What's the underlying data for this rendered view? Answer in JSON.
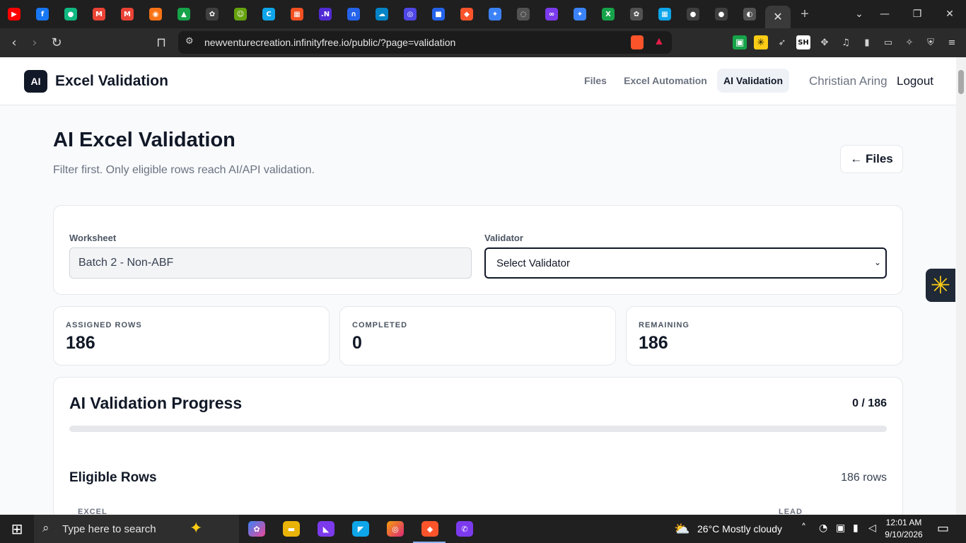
{
  "browser": {
    "tabs": [
      {
        "icon": "youtube-icon",
        "glyph": "▶",
        "color": "#ff0000"
      },
      {
        "icon": "facebook-icon",
        "glyph": "f",
        "color": "#1877f2"
      },
      {
        "icon": "chat-icon",
        "glyph": "●",
        "color": "#10b981"
      },
      {
        "icon": "gmail-icon",
        "glyph": "M",
        "color": "#ea4335"
      },
      {
        "icon": "gmail-icon",
        "glyph": "M",
        "color": "#ea4335"
      },
      {
        "icon": "app-icon",
        "glyph": "◉",
        "color": "#f97316"
      },
      {
        "icon": "drive-icon",
        "glyph": "▲",
        "color": "#16a34a"
      },
      {
        "icon": "openai-icon",
        "glyph": "✿",
        "color": "#3f3f3f"
      },
      {
        "icon": "robot-icon",
        "glyph": "☺",
        "color": "#65a30d"
      },
      {
        "icon": "copilot-icon",
        "glyph": "C",
        "color": "#0ea5e9"
      },
      {
        "icon": "microsoft-icon",
        "glyph": "▦",
        "color": "#f25022"
      },
      {
        "icon": "dotnet-icon",
        "glyph": ".N",
        "color": "#512bd4"
      },
      {
        "icon": "wave-icon",
        "glyph": "∩",
        "color": "#2563eb"
      },
      {
        "icon": "cloud-icon",
        "glyph": "☁",
        "color": "#0284c7"
      },
      {
        "icon": "globe-icon",
        "glyph": "◎",
        "color": "#4f46e5"
      },
      {
        "icon": "square-icon",
        "glyph": "■",
        "color": "#2563eb"
      },
      {
        "icon": "brave-icon",
        "glyph": "◆",
        "color": "#fb542b"
      },
      {
        "icon": "gemini-icon",
        "glyph": "✦",
        "color": "#3b82f6"
      },
      {
        "icon": "loading-icon",
        "glyph": "◌",
        "color": "#525252"
      },
      {
        "icon": "infinity-icon",
        "glyph": "∞",
        "color": "#7c3aed"
      },
      {
        "icon": "gemini-icon",
        "glyph": "✦",
        "color": "#3b82f6"
      },
      {
        "icon": "excel-icon",
        "glyph": "X",
        "color": "#16a34a"
      },
      {
        "icon": "openai-icon",
        "glyph": "✿",
        "color": "#525252"
      },
      {
        "icon": "grid-icon",
        "glyph": "▦",
        "color": "#0ea5e9"
      },
      {
        "icon": "github-icon",
        "glyph": "●",
        "color": "#3f3f3f"
      },
      {
        "icon": "github-icon",
        "glyph": "●",
        "color": "#3f3f3f"
      },
      {
        "icon": "globe-icon",
        "glyph": "◐",
        "color": "#525252"
      }
    ],
    "active_tab_close": "✕",
    "new_tab": "+",
    "url": "newventurecreation.infinityfree.io/public/?page=validation"
  },
  "nav": {
    "logo": "AI",
    "brand": "Excel Validation",
    "links": [
      "Files",
      "Excel Automation",
      "AI Validation"
    ],
    "user": "Christian Aring",
    "logout": "Logout"
  },
  "header": {
    "title": "AI Excel Validation",
    "subtitle": "Filter first. Only eligible rows reach AI/API validation.",
    "files_button": "← Files"
  },
  "filters": {
    "worksheet_label": "Worksheet",
    "worksheet_value": "Batch 2 - Non-ABF",
    "validator_label": "Validator",
    "validator_value": "Select Validator"
  },
  "stats": [
    {
      "label": "ASSIGNED ROWS",
      "value": "186"
    },
    {
      "label": "COMPLETED",
      "value": "0"
    },
    {
      "label": "REMAINING",
      "value": "186"
    }
  ],
  "progress": {
    "title": "AI Validation Progress",
    "count": "0 / 186",
    "fraction": 0,
    "eligible_title": "Eligible Rows",
    "eligible_count": "186 rows",
    "col_excel": "EXCEL",
    "col_lead": "LEAD"
  },
  "taskbar": {
    "search_placeholder": "Type here to search",
    "weather": "26°C  Mostly cloudy",
    "time": "12:01 AM",
    "date": "9/10/2026"
  }
}
